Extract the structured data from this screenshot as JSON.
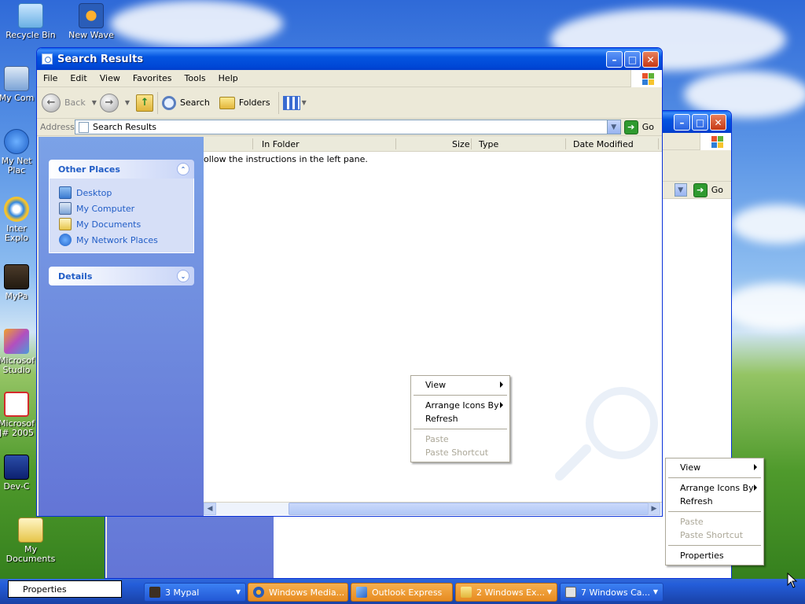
{
  "desktop": {
    "icons": [
      {
        "label": "Recycle Bin"
      },
      {
        "label": "New Wave"
      },
      {
        "label": "My Com"
      },
      {
        "label": "My Net Plac"
      },
      {
        "label": "Inter Explo"
      },
      {
        "label": "MyPa"
      },
      {
        "label": "Microsof Studio"
      },
      {
        "label": "Microsof J# 2005"
      },
      {
        "label": "Dev-C"
      },
      {
        "label": "My Documents"
      }
    ]
  },
  "back_window": {
    "go_label": "Go"
  },
  "main_window": {
    "title": "Search Results",
    "menu": [
      "File",
      "Edit",
      "View",
      "Favorites",
      "Tools",
      "Help"
    ],
    "toolbar": {
      "back": "Back",
      "search": "Search",
      "folders": "Folders"
    },
    "address": {
      "label": "Address",
      "value": "Search Results",
      "go": "Go"
    },
    "other_places": {
      "title": "Other Places",
      "items": [
        "Desktop",
        "My Computer",
        "My Documents",
        "My Network Places"
      ]
    },
    "details": {
      "title": "Details"
    },
    "columns": [
      "In Folder",
      "Size",
      "Type",
      "Date Modified"
    ],
    "message": "ollow the instructions in the left pane."
  },
  "context_menu_1": {
    "items": [
      {
        "label": "View",
        "submenu": true,
        "disabled": false
      },
      {
        "label": "Arrange Icons By",
        "submenu": true,
        "disabled": false
      },
      {
        "label": "Refresh",
        "submenu": false,
        "disabled": false
      },
      {
        "label": "Paste",
        "submenu": false,
        "disabled": true
      },
      {
        "label": "Paste Shortcut",
        "submenu": false,
        "disabled": true
      }
    ]
  },
  "context_menu_2": {
    "items": [
      {
        "label": "View",
        "submenu": true,
        "disabled": false
      },
      {
        "label": "Arrange Icons By",
        "submenu": true,
        "disabled": false
      },
      {
        "label": "Refresh",
        "submenu": false,
        "disabled": false
      },
      {
        "label": "Paste",
        "submenu": false,
        "disabled": true
      },
      {
        "label": "Paste Shortcut",
        "submenu": false,
        "disabled": true
      },
      {
        "label": "Properties",
        "submenu": false,
        "disabled": false
      }
    ]
  },
  "tooltip": {
    "label": "Properties"
  },
  "taskbar": {
    "items": [
      {
        "label": "3 Mypal",
        "active": false
      },
      {
        "label": "Windows Media...",
        "active": false
      },
      {
        "label": "Outlook Express",
        "active": false
      },
      {
        "label": "2 Windows Ex...",
        "active": false
      },
      {
        "label": "7 Windows Ca...",
        "active": false
      }
    ]
  },
  "colors": {
    "xp_blue": "#0047d6",
    "task_link": "#215dc6",
    "taskbar_orange": "#e78b20"
  }
}
